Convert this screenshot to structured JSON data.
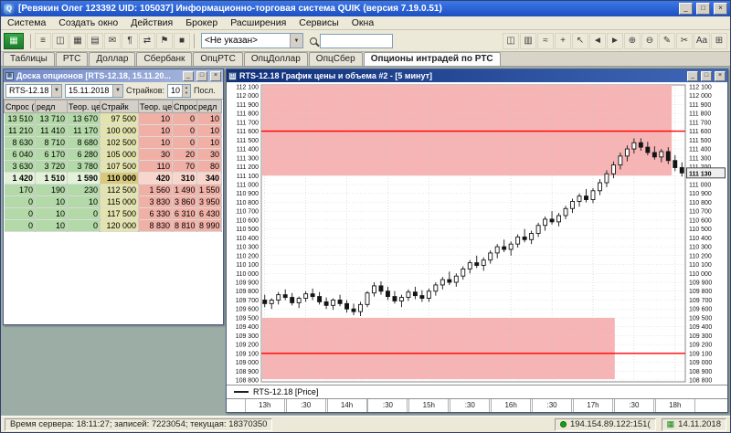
{
  "titlebar": {
    "title": "[Ревякин Олег 123392 UID: 105037] Информационно-торговая система QUIK (версия 7.19.0.51)",
    "app_icon": "Q"
  },
  "window_controls": {
    "minimize": "_",
    "maximize": "□",
    "close": "×"
  },
  "icons": {
    "dropdown": "▼",
    "up": "▲",
    "down": "▼",
    "terminal": "▦",
    "calendar": "▦"
  },
  "menu": {
    "items": [
      "Система",
      "Создать окно",
      "Действия",
      "Брокер",
      "Расширения",
      "Сервисы",
      "Окна"
    ]
  },
  "toolbar": {
    "left_icons": [
      {
        "name": "order-book-icon",
        "glyph": "≡"
      },
      {
        "name": "new-chart-icon",
        "glyph": "◫"
      },
      {
        "name": "new-table-icon",
        "glyph": "▦"
      },
      {
        "name": "quotes-icon",
        "glyph": "▤"
      },
      {
        "name": "messages-icon",
        "glyph": "✉"
      },
      {
        "name": "news-icon",
        "glyph": "¶"
      },
      {
        "name": "export-icon",
        "glyph": "⇄"
      },
      {
        "name": "flag-icon",
        "glyph": "⚑"
      },
      {
        "name": "stop-icon",
        "glyph": "■"
      }
    ],
    "instrument_combo": "<Не указан>",
    "search_value": "",
    "right_icons": [
      {
        "name": "candles-icon",
        "glyph": "◫"
      },
      {
        "name": "bars-icon",
        "glyph": "▥"
      },
      {
        "name": "line-chart-icon",
        "glyph": "≈"
      },
      {
        "name": "crosshair-icon",
        "glyph": "+"
      },
      {
        "name": "pointer-icon",
        "glyph": "↖"
      },
      {
        "name": "pan-left-icon",
        "glyph": "◄"
      },
      {
        "name": "pan-right-icon",
        "glyph": "►"
      },
      {
        "name": "zoom-in-icon",
        "glyph": "⊕"
      },
      {
        "name": "zoom-out-icon",
        "glyph": "⊖"
      },
      {
        "name": "draw-icon",
        "glyph": "✎"
      },
      {
        "name": "erase-icon",
        "glyph": "✂"
      },
      {
        "name": "text-tool-icon",
        "glyph": "Aa"
      },
      {
        "name": "grid-icon",
        "glyph": "⊞"
      }
    ]
  },
  "tabs": {
    "items": [
      "Таблицы",
      "РТС",
      "Доллар",
      "Сбербанк",
      "ОпцРТС",
      "ОпцДоллар",
      "ОпцСбер",
      "Опционы интрадей по РТС"
    ],
    "active_index": 7
  },
  "options_window": {
    "title": "Доска опционов [RTS-12.18, 15.11.20...",
    "toolbar": {
      "instrument": "RTS-12.18",
      "date": "15.11.2018",
      "strikes_label": "Страйков:",
      "strikes_value": "10",
      "last_label": "Посл."
    },
    "table": {
      "headers": [
        "Спрос (П",
        "редл",
        "Теор. цена С",
        "Страйк",
        "Теор. цена П",
        "Спрос (П",
        "редл"
      ],
      "highlight_row": 5,
      "rows": [
        [
          "13 510",
          "13 710",
          "13 670",
          "97 500",
          "10",
          "0",
          "10"
        ],
        [
          "11 210",
          "11 410",
          "11 170",
          "100 000",
          "10",
          "0",
          "10"
        ],
        [
          "8 630",
          "8 710",
          "8 680",
          "102 500",
          "10",
          "0",
          "10"
        ],
        [
          "6 040",
          "6 170",
          "6 280",
          "105 000",
          "30",
          "20",
          "30"
        ],
        [
          "3 630",
          "3 720",
          "3 780",
          "107 500",
          "110",
          "70",
          "80"
        ],
        [
          "1 420",
          "1 510",
          "1 590",
          "110 000",
          "420",
          "310",
          "340"
        ],
        [
          "170",
          "190",
          "230",
          "112 500",
          "1 560",
          "1 490",
          "1 550"
        ],
        [
          "0",
          "10",
          "10",
          "115 000",
          "3 830",
          "3 860",
          "3 950"
        ],
        [
          "0",
          "10",
          "0",
          "117 500",
          "6 330",
          "6 310",
          "6 430"
        ],
        [
          "0",
          "10",
          "0",
          "120 000",
          "8 830",
          "8 810",
          "8 990"
        ]
      ]
    }
  },
  "chart_window": {
    "title": "RTS-12.18 График цены и объема #2 - [5 минут]",
    "legend": "RTS-12.18 [Price]"
  },
  "chart_data": {
    "type": "candlestick",
    "instrument": "RTS-12.18",
    "interval": "5 минут",
    "ylim": [
      108780,
      112120
    ],
    "axis_label_min": 108800,
    "axis_label_max": 112100,
    "tick_step": 100,
    "x_labels": [
      "13h",
      ":30",
      "14h",
      ":30",
      "15h",
      ":30",
      "16h",
      ":30",
      "17h",
      ":30",
      "18h"
    ],
    "x_label_candle_indices": [
      0,
      6,
      12,
      18,
      24,
      30,
      36,
      42,
      48,
      54,
      60
    ],
    "red_lines": [
      111600,
      109100
    ],
    "line_color": "#ff0000",
    "band_color": "#f6b4b4",
    "bands": [
      {
        "from": 111100,
        "to": 112120,
        "width_frac": 0.97
      },
      {
        "from": 108810,
        "to": 109500,
        "width_frac": 0.835
      }
    ],
    "last_price_label": "111 130",
    "candles_ohlc": [
      [
        109700,
        109760,
        109620,
        109660
      ],
      [
        109660,
        109720,
        109600,
        109700
      ],
      [
        109700,
        109790,
        109650,
        109760
      ],
      [
        109760,
        109820,
        109700,
        109730
      ],
      [
        109730,
        109780,
        109640,
        109670
      ],
      [
        109670,
        109740,
        109610,
        109720
      ],
      [
        109720,
        109800,
        109680,
        109770
      ],
      [
        109770,
        109830,
        109700,
        109740
      ],
      [
        109740,
        109790,
        109650,
        109680
      ],
      [
        109680,
        109730,
        109600,
        109640
      ],
      [
        109640,
        109720,
        109590,
        109700
      ],
      [
        109700,
        109760,
        109630,
        109660
      ],
      [
        109660,
        109700,
        109560,
        109600
      ],
      [
        109600,
        109660,
        109530,
        109570
      ],
      [
        109570,
        109680,
        109520,
        109650
      ],
      [
        109650,
        109800,
        109620,
        109780
      ],
      [
        109780,
        109900,
        109740,
        109860
      ],
      [
        109860,
        109910,
        109760,
        109800
      ],
      [
        109800,
        109850,
        109700,
        109740
      ],
      [
        109740,
        109800,
        109660,
        109690
      ],
      [
        109690,
        109760,
        109620,
        109730
      ],
      [
        109730,
        109820,
        109690,
        109790
      ],
      [
        109790,
        109850,
        109710,
        109750
      ],
      [
        109750,
        109810,
        109680,
        109720
      ],
      [
        109720,
        109830,
        109680,
        109800
      ],
      [
        109800,
        109900,
        109750,
        109870
      ],
      [
        109870,
        109960,
        109820,
        109930
      ],
      [
        109930,
        110020,
        109870,
        109900
      ],
      [
        109900,
        110000,
        109850,
        109970
      ],
      [
        109970,
        110080,
        109930,
        110050
      ],
      [
        110050,
        110150,
        110000,
        110120
      ],
      [
        110120,
        110200,
        110060,
        110090
      ],
      [
        110090,
        110180,
        110030,
        110150
      ],
      [
        110150,
        110260,
        110110,
        110230
      ],
      [
        110230,
        110330,
        110170,
        110300
      ],
      [
        110300,
        110380,
        110240,
        110270
      ],
      [
        110270,
        110360,
        110200,
        110330
      ],
      [
        110330,
        110440,
        110290,
        110410
      ],
      [
        110410,
        110500,
        110350,
        110380
      ],
      [
        110380,
        110480,
        110330,
        110450
      ],
      [
        110450,
        110570,
        110410,
        110540
      ],
      [
        110540,
        110640,
        110480,
        110610
      ],
      [
        110610,
        110700,
        110550,
        110580
      ],
      [
        110580,
        110680,
        110530,
        110650
      ],
      [
        110650,
        110760,
        110610,
        110730
      ],
      [
        110730,
        110840,
        110680,
        110810
      ],
      [
        110810,
        110900,
        110750,
        110870
      ],
      [
        110870,
        110950,
        110800,
        110830
      ],
      [
        110830,
        110960,
        110790,
        110930
      ],
      [
        110930,
        111060,
        110880,
        111020
      ],
      [
        111020,
        111160,
        110970,
        111120
      ],
      [
        111120,
        111260,
        111070,
        111220
      ],
      [
        111220,
        111360,
        111170,
        111320
      ],
      [
        111320,
        111440,
        111260,
        111400
      ],
      [
        111400,
        111520,
        111350,
        111470
      ],
      [
        111470,
        111520,
        111380,
        111420
      ],
      [
        111420,
        111480,
        111330,
        111360
      ],
      [
        111360,
        111430,
        111280,
        111310
      ],
      [
        111310,
        111400,
        111250,
        111370
      ],
      [
        111370,
        111420,
        111230,
        111270
      ],
      [
        111270,
        111330,
        111150,
        111190
      ],
      [
        111190,
        111250,
        111090,
        111130
      ]
    ]
  },
  "statusbar": {
    "server": "Время сервера: 18:11:27; записей: 7223054; текущая: 18370350",
    "connection": "194.154.89.122:151(",
    "date": "14.11.2018"
  }
}
